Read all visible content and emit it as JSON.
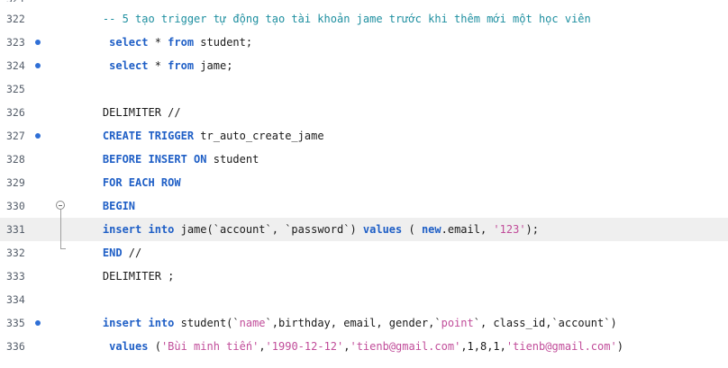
{
  "editor": {
    "lines": [
      {
        "num": "322",
        "dot": false,
        "highlight": false,
        "fold": "",
        "tokens": [
          {
            "t": "    -- 5 tạo trigger tự động tạo tài khoản jame trước khi thêm mới một học viên",
            "c": "comment"
          }
        ]
      },
      {
        "num": "323",
        "dot": true,
        "highlight": false,
        "fold": "",
        "tokens": [
          {
            "t": "     select",
            "c": "kw"
          },
          {
            "t": " * ",
            "c": "plain"
          },
          {
            "t": "from",
            "c": "kw"
          },
          {
            "t": " student;",
            "c": "plain"
          }
        ]
      },
      {
        "num": "324",
        "dot": true,
        "highlight": false,
        "fold": "",
        "tokens": [
          {
            "t": "     select",
            "c": "kw"
          },
          {
            "t": " * ",
            "c": "plain"
          },
          {
            "t": "from",
            "c": "kw"
          },
          {
            "t": " jame;",
            "c": "plain"
          }
        ]
      },
      {
        "num": "325",
        "dot": false,
        "highlight": false,
        "fold": "",
        "tokens": []
      },
      {
        "num": "326",
        "dot": false,
        "highlight": false,
        "fold": "",
        "tokens": [
          {
            "t": "    DELIMITER //",
            "c": "plain"
          }
        ]
      },
      {
        "num": "327",
        "dot": true,
        "highlight": false,
        "fold": "",
        "tokens": [
          {
            "t": "    CREATE TRIGGER",
            "c": "kw"
          },
          {
            "t": " tr_auto_create_jame",
            "c": "plain"
          }
        ]
      },
      {
        "num": "328",
        "dot": false,
        "highlight": false,
        "fold": "",
        "tokens": [
          {
            "t": "    BEFORE INSERT ON",
            "c": "kw"
          },
          {
            "t": " student",
            "c": "plain"
          }
        ]
      },
      {
        "num": "329",
        "dot": false,
        "highlight": false,
        "fold": "",
        "tokens": [
          {
            "t": "    FOR EACH ROW",
            "c": "kw"
          }
        ]
      },
      {
        "num": "330",
        "dot": false,
        "highlight": false,
        "fold": "start",
        "tokens": [
          {
            "t": "    BEGIN",
            "c": "kw"
          }
        ]
      },
      {
        "num": "331",
        "dot": false,
        "highlight": true,
        "fold": "mid",
        "tokens": [
          {
            "t": "    insert into",
            "c": "kw"
          },
          {
            "t": " jame(`account`, `password`) ",
            "c": "plain"
          },
          {
            "t": "values",
            "c": "kw"
          },
          {
            "t": " ( ",
            "c": "plain"
          },
          {
            "t": "new",
            "c": "kw"
          },
          {
            "t": ".email, ",
            "c": "plain"
          },
          {
            "t": "'123'",
            "c": "str"
          },
          {
            "t": ");",
            "c": "plain"
          }
        ]
      },
      {
        "num": "332",
        "dot": false,
        "highlight": false,
        "fold": "end",
        "tokens": [
          {
            "t": "    END",
            "c": "kw"
          },
          {
            "t": " //",
            "c": "plain"
          }
        ]
      },
      {
        "num": "333",
        "dot": false,
        "highlight": false,
        "fold": "",
        "tokens": [
          {
            "t": "    DELIMITER ;",
            "c": "plain"
          }
        ]
      },
      {
        "num": "334",
        "dot": false,
        "highlight": false,
        "fold": "",
        "tokens": []
      },
      {
        "num": "335",
        "dot": true,
        "highlight": false,
        "fold": "",
        "tokens": [
          {
            "t": "    insert into",
            "c": "kw"
          },
          {
            "t": " student(`",
            "c": "plain"
          },
          {
            "t": "name",
            "c": "str"
          },
          {
            "t": "`,birthday, email, gender,`",
            "c": "plain"
          },
          {
            "t": "point",
            "c": "str"
          },
          {
            "t": "`, class_id,`account`)",
            "c": "plain"
          }
        ]
      },
      {
        "num": "336",
        "dot": false,
        "highlight": false,
        "fold": "",
        "tokens": [
          {
            "t": "     values",
            "c": "kw"
          },
          {
            "t": " (",
            "c": "plain"
          },
          {
            "t": "'Bùi minh tiến'",
            "c": "str"
          },
          {
            "t": ",",
            "c": "plain"
          },
          {
            "t": "'1990-12-12'",
            "c": "str"
          },
          {
            "t": ",",
            "c": "plain"
          },
          {
            "t": "'tienb@gmail.com'",
            "c": "str"
          },
          {
            "t": ",1,8,1,",
            "c": "plain"
          },
          {
            "t": "'tienb@gmail.com'",
            "c": "str"
          },
          {
            "t": ")",
            "c": "plain"
          }
        ]
      }
    ]
  }
}
